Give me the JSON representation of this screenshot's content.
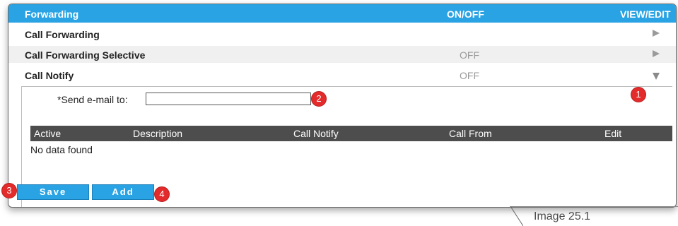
{
  "header": {
    "section": "Forwarding",
    "onoff": "ON/OFF",
    "viewedit": "VIEW/EDIT"
  },
  "rows": [
    {
      "label": "Call Forwarding",
      "status": ""
    },
    {
      "label": "Call Forwarding Selective",
      "status": "OFF"
    },
    {
      "label": "Call Notify",
      "status": "OFF"
    }
  ],
  "call_notify": {
    "email_label": "*Send e-mail to:",
    "email_value": "",
    "table": {
      "columns": [
        "Active",
        "Description",
        "Call Notify",
        "Call From",
        "Edit"
      ],
      "empty_text": "No data found"
    },
    "buttons": {
      "save": "Save",
      "add": "Add"
    }
  },
  "callouts": [
    "1",
    "2",
    "3",
    "4"
  ],
  "caption": "Image 25.1",
  "colors": {
    "accent": "#29a3e4",
    "table_header": "#4d4d4d",
    "callout": "#e32b2b"
  }
}
